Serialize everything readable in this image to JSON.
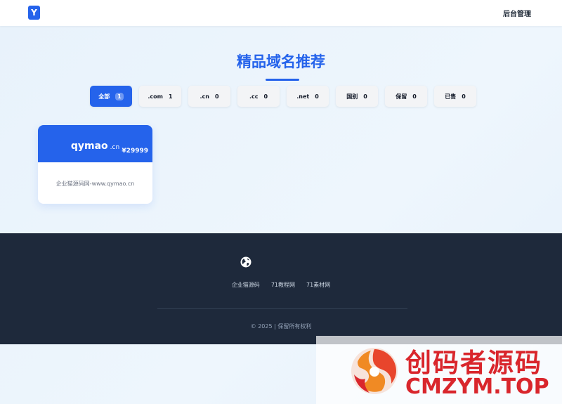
{
  "header": {
    "logo_letter": "Y",
    "admin_label": "后台管理"
  },
  "main": {
    "title": "精品域名推荐",
    "filters": [
      {
        "label": "全部",
        "count": "1"
      },
      {
        "label": ".com",
        "count": "1"
      },
      {
        "label": ".cn",
        "count": "0"
      },
      {
        "label": ".cc",
        "count": "0"
      },
      {
        "label": ".net",
        "count": "0"
      },
      {
        "label": "国别",
        "count": "0"
      },
      {
        "label": "保留",
        "count": "0"
      },
      {
        "label": "已售",
        "count": "0"
      }
    ],
    "domains": [
      {
        "name": "qymao",
        "ext": ".cn",
        "price": "¥29999",
        "description": "企业猫源码网-www.qymao.cn"
      }
    ]
  },
  "footer": {
    "links": [
      "企业猫源码",
      "71教程网",
      "71素材网"
    ],
    "copyright": "© 2025 | 保留所有权利"
  },
  "watermark": {
    "line1": "创码者源码",
    "line2": "CMZYM.TOP"
  },
  "colors": {
    "brand": "#2563eb",
    "footer_bg": "#1e293b",
    "watermark": "#d9262c"
  }
}
